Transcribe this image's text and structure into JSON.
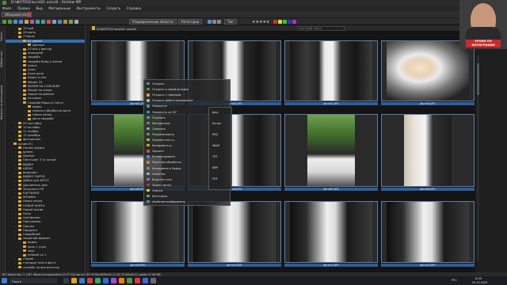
{
  "titlebar": {
    "title": "D:\\ФОТО\\Ольга\\01 uvicell - XnView MP",
    "minimize": "–",
    "maximize": "▢",
    "close": "✕"
  },
  "menubar": {
    "items": [
      "Файл",
      "Правка",
      "Вид",
      "Метаданные",
      "Инструменты",
      "Создать",
      "Справка"
    ]
  },
  "tabs": {
    "browser": "Обозреватель"
  },
  "toolbar2": {
    "view_label": "Упорядоченные области",
    "filter_label": "Категории",
    "sort_label": "Тип"
  },
  "pathbar": {
    "path": "D:\\ФОТО\\Ольга\\01 uvicell",
    "search_placeholder": "Быстрый поиск"
  },
  "sidetabs": [
    "Папки",
    "Избранное",
    "Фильтр по категориям"
  ],
  "tree": {
    "items": [
      {
        "label": "19 май",
        "indent": 2
      },
      {
        "label": "26 июнь",
        "indent": 2
      },
      {
        "label": "27июль",
        "indent": 2
      },
      {
        "label": "01 uvicell",
        "indent": 3,
        "selected": true
      },
      {
        "label": "Данные",
        "indent": 4
      },
      {
        "label": "03 всё у виктор",
        "indent": 3
      },
      {
        "label": "апицелий",
        "indent": 3
      },
      {
        "label": "свадьба",
        "indent": 3
      },
      {
        "label": "свадьба Влад и Алена",
        "indent": 3
      },
      {
        "label": "Алена",
        "indent": 3
      },
      {
        "label": "Алла",
        "indent": 3
      },
      {
        "label": "Алла дела",
        "indent": 3
      },
      {
        "label": "Борис и Аля",
        "indent": 3
      },
      {
        "label": "Мария 24",
        "indent": 3
      },
      {
        "label": "МАРИЯ НА ГАЗЕЛЬКЕ",
        "indent": 3
      },
      {
        "label": "Мария на озеро",
        "indent": 3
      },
      {
        "label": "мария на диноке",
        "indent": 3
      },
      {
        "label": "на озере",
        "indent": 3
      },
      {
        "label": "Свадьба Миша и Света",
        "indent": 3
      },
      {
        "label": "видео",
        "indent": 4
      },
      {
        "label": "нарезка обработка фото",
        "indent": 4
      },
      {
        "label": "Новая папка",
        "indent": 4
      },
      {
        "label": "фото свадьба",
        "indent": 4
      },
      {
        "label": "09 сентябрь",
        "indent": 2
      },
      {
        "label": "10 октябрь",
        "indent": 2
      },
      {
        "label": "11 ноябрь",
        "indent": 2
      },
      {
        "label": "12 декабрь",
        "indent": 2
      },
      {
        "label": "фотошопик",
        "indent": 2
      },
      {
        "label": "архив (F:)",
        "indent": 1
      },
      {
        "label": "Heroes Exodus",
        "indent": 2
      },
      {
        "label": "games",
        "indent": 2
      },
      {
        "label": "slovfest",
        "indent": 2
      },
      {
        "label": "ПингСофт 3 ту китай",
        "indent": 2
      },
      {
        "label": "ВИДЕО",
        "indent": 2
      },
      {
        "label": "АЛЕКС",
        "indent": 2
      },
      {
        "label": "видеоарт",
        "indent": 2
      },
      {
        "label": "ВИДЕО СЫРОЕ",
        "indent": 2
      },
      {
        "label": "Добро для ФОТО",
        "indent": 2
      },
      {
        "label": "Документы дом",
        "indent": 2
      },
      {
        "label": "Загрузить ПК",
        "indent": 2
      },
      {
        "label": "КАРТИНКИ",
        "indent": 2
      },
      {
        "label": "МУЗЫКА",
        "indent": 2
      },
      {
        "label": "Новая папка",
        "indent": 2
      },
      {
        "label": "НОВАЯ КНИГА",
        "indent": 2
      },
      {
        "label": "Новый Архив",
        "indent": 2
      },
      {
        "label": "Ноты",
        "indent": 2
      },
      {
        "label": "портфолио",
        "indent": 2
      },
      {
        "label": "Программы",
        "indent": 2
      },
      {
        "label": "Прочее",
        "indent": 2
      },
      {
        "label": "Продажи",
        "indent": 2
      },
      {
        "label": "Свадебный",
        "indent": 2
      },
      {
        "label": "сведений формат",
        "indent": 2
      },
      {
        "label": "видео",
        "indent": 3
      },
      {
        "label": "день 1 утро",
        "indent": 3
      },
      {
        "label": "звук",
        "indent": 3
      },
      {
        "label": "первый кл 1",
        "indent": 3
      },
      {
        "label": "старая",
        "indent": 2
      },
      {
        "label": "стандарт всего фото",
        "indent": 2
      },
      {
        "label": "спасибо за фотосессию",
        "indent": 2
      }
    ]
  },
  "thumbnails": [
    {
      "caption": "фото01.JPG",
      "scene": "gate"
    },
    {
      "caption": "фото02.JPG",
      "scene": "gate"
    },
    {
      "caption": "фото03.JPG",
      "scene": "gate"
    },
    {
      "caption": "фото04.JPG",
      "scene": "close"
    },
    {
      "caption": "фото05.JPG",
      "scene": "tree"
    },
    {
      "caption": "фото06.JPG",
      "scene": "gate"
    },
    {
      "caption": "фото07.JPG",
      "scene": "tree"
    },
    {
      "caption": "фото08.JPG",
      "scene": "gatewide"
    },
    {
      "caption": "фото09.JPG",
      "scene": "dark"
    },
    {
      "caption": "фото10.JPG",
      "scene": "dark"
    },
    {
      "caption": "фото11.JPG",
      "scene": "dark"
    },
    {
      "caption": "фото12.JPG",
      "scene": "dark"
    }
  ],
  "context_menu": {
    "items": [
      "Открыть",
      "Открыть в новой вкладке",
      "Открыть с помощью",
      "Открыть файл в проводнике",
      "Повернуть",
      "Повернуть на 90°",
      "Отразить",
      "Метаданные",
      "Сравнить",
      "Переименовать",
      "Переместить в...",
      "Копировать в...",
      "Удалить",
      "Конвертировать",
      "Пакетная обработка",
      "Копировать в буфер",
      "Свойства",
      "Выделить все",
      "Задать метку",
      "Оценка",
      "Категории",
      "Свойства изображения"
    ],
    "submenu": [
      "Jpeg",
      "Копия",
      "PNG",
      "WebP",
      "TIFF",
      "BMP",
      "PDF"
    ]
  },
  "statusbar": {
    "text": "187 объектов / 1 (187 объектов выделено [4.37 ГБ])   фото1.JPG   6745x4496x24 (1.50)   33.84x42.41 дюйм   27.68 МБ"
  },
  "taskbar": {
    "search": "Поиск",
    "time": "8:40",
    "date": "05.10.2020",
    "lang": "РУС"
  },
  "presenter": {
    "caption": "УРОКИ ПО ФОТОГРАФИИ"
  },
  "colors": {
    "accent": "#2d5f99",
    "folder": "#d9a83a",
    "selection": "#2f6fb3"
  }
}
